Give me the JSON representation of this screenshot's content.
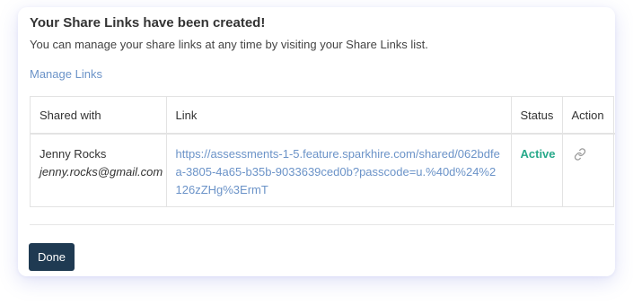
{
  "dialog": {
    "title": "Your Share Links have been created!",
    "subtitle": "You can manage your share links at any time by visiting your Share Links list.",
    "manage_link_label": "Manage Links"
  },
  "table": {
    "headers": {
      "shared_with": "Shared with",
      "link": "Link",
      "status": "Status",
      "action": "Action"
    },
    "rows": [
      {
        "name": "Jenny Rocks",
        "email": "jenny.rocks@gmail.com",
        "url": "https://assessments-1-5.feature.sparkhire.com/shared/062bdfea-3805-4a65-b35b-9033639ced0b?passcode=u.%40d%24%2126zZHg%3ErmT",
        "status": "Active",
        "action_icon": "link-icon"
      }
    ]
  },
  "footer": {
    "done_label": "Done"
  },
  "colors": {
    "accent_link": "#6b93c8",
    "status_active": "#27a98a",
    "primary_button": "#1f3a52"
  }
}
